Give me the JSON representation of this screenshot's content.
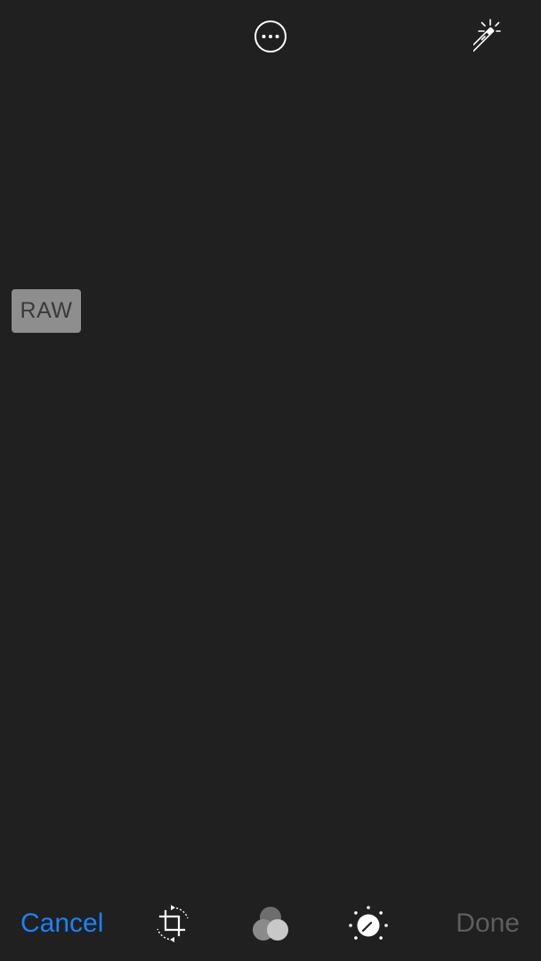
{
  "top_bar": {
    "more_icon": "ellipsis-circle-icon",
    "auto_enhance_icon": "magic-wand-icon"
  },
  "image_area": {
    "badge_label": "RAW"
  },
  "toolbar": {
    "cancel_label": "Cancel",
    "done_label": "Done",
    "tools": [
      {
        "icon": "crop-rotate-icon"
      },
      {
        "icon": "filters-icon"
      },
      {
        "icon": "adjust-dial-icon"
      }
    ]
  },
  "colors": {
    "background": "#202020",
    "accent": "#1a82fb",
    "disabled": "#5e5e5e",
    "badge": "#8e8e8e"
  }
}
